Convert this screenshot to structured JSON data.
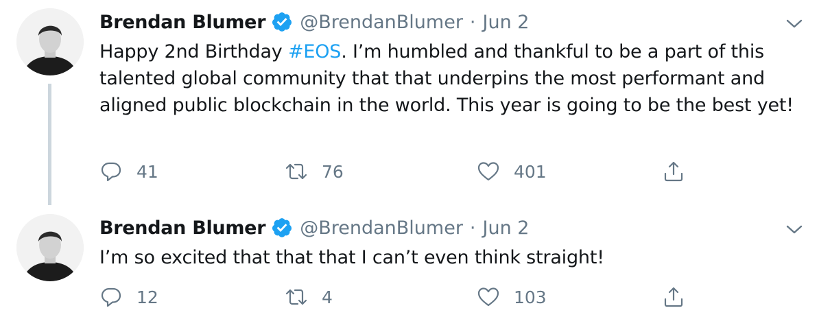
{
  "tweets": [
    {
      "name": "Brendan Blumer",
      "handle": "@BrendanBlumer",
      "separator": "·",
      "date": "Jun 2",
      "text_before": "Happy 2nd Birthday ",
      "hashtag": "#EOS",
      "text_after": ". I’m humbled and thankful to be a part of this talented global community that that underpins the most performant and aligned public blockchain in the world. This year is going to be the best yet!",
      "reply_count": "41",
      "retweet_count": "76",
      "like_count": "401"
    },
    {
      "name": "Brendan Blumer",
      "handle": "@BrendanBlumer",
      "separator": "·",
      "date": "Jun 2",
      "text": "I’m so excited that that that I can’t even think straight!",
      "reply_count": "12",
      "retweet_count": "4",
      "like_count": "103"
    }
  ],
  "icons": {
    "verified": "verified-badge-icon",
    "caret": "chevron-down-icon",
    "reply": "reply-icon",
    "retweet": "retweet-icon",
    "like": "heart-icon",
    "share": "share-icon"
  },
  "colors": {
    "text": "#14171a",
    "muted": "#657786",
    "accent": "#1da1f2",
    "thread_line": "#ccd6dd"
  }
}
